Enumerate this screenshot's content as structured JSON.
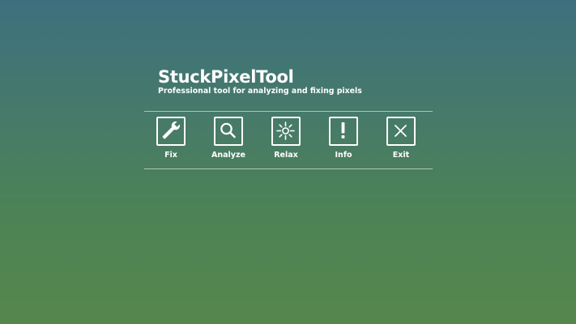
{
  "app": {
    "title": "StuckPixelTool",
    "subtitle": "Professional tool for analyzing and fixing pixels"
  },
  "toolbar": {
    "items": [
      {
        "label": "Fix",
        "icon": "wrench-icon"
      },
      {
        "label": "Analyze",
        "icon": "magnifier-icon"
      },
      {
        "label": "Relax",
        "icon": "sun-icon"
      },
      {
        "label": "Info",
        "icon": "exclamation-icon"
      },
      {
        "label": "Exit",
        "icon": "close-icon"
      }
    ]
  },
  "colors": {
    "background_top": "#3d707e",
    "background_bottom": "#55874c",
    "foreground": "#ffffff"
  }
}
